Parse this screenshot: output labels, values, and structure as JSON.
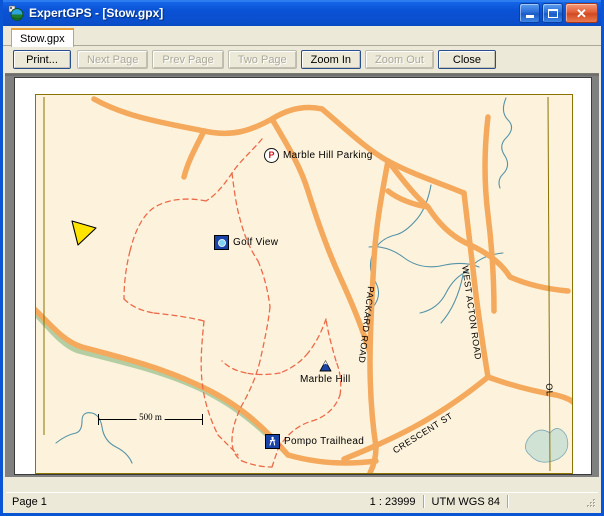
{
  "window": {
    "title": "ExpertGPS - [Stow.gpx]",
    "icon": "globe-icon",
    "minimize_label": "",
    "maximize_label": "",
    "close_label": "✕"
  },
  "tabs": [
    {
      "label": "Stow.gpx",
      "active": true
    }
  ],
  "toolbar": {
    "buttons": [
      {
        "label": "Print...",
        "name": "print-button",
        "enabled": true,
        "default": true
      },
      {
        "label": "Next Page",
        "name": "next-page-button",
        "enabled": false,
        "default": false
      },
      {
        "label": "Prev Page",
        "name": "prev-page-button",
        "enabled": false,
        "default": false
      },
      {
        "label": "Two Page",
        "name": "two-page-button",
        "enabled": false,
        "default": false
      },
      {
        "label": "Zoom In",
        "name": "zoom-in-button",
        "enabled": true,
        "default": true
      },
      {
        "label": "Zoom Out",
        "name": "zoom-out-button",
        "enabled": false,
        "default": false
      },
      {
        "label": "Close",
        "name": "close-preview-button",
        "enabled": true,
        "default": true
      }
    ]
  },
  "map": {
    "background_color": "#fdf3dc",
    "border_color": "#8a7300",
    "road_color": "#f7ae63",
    "stream_color": "#4e8ea3",
    "track_color": "#e8664a",
    "green_color": "#aec79a",
    "scale": {
      "label": "500 m"
    },
    "waypoints": [
      {
        "name": "Marble Hill Parking",
        "icon": "parking-icon"
      },
      {
        "name": "Golf View",
        "icon": "camera-icon"
      },
      {
        "name": "Marble Hill",
        "icon": "summit-icon"
      },
      {
        "name": "Pompo Trailhead",
        "icon": "hiker-icon"
      }
    ],
    "road_labels": [
      "PACKARD ROAD",
      "WEST ACTON ROAD",
      "CRESCENT ST",
      "OL"
    ]
  },
  "statusbar": {
    "page": "Page 1",
    "scale": "1 : 23999",
    "datum": "UTM WGS 84"
  }
}
